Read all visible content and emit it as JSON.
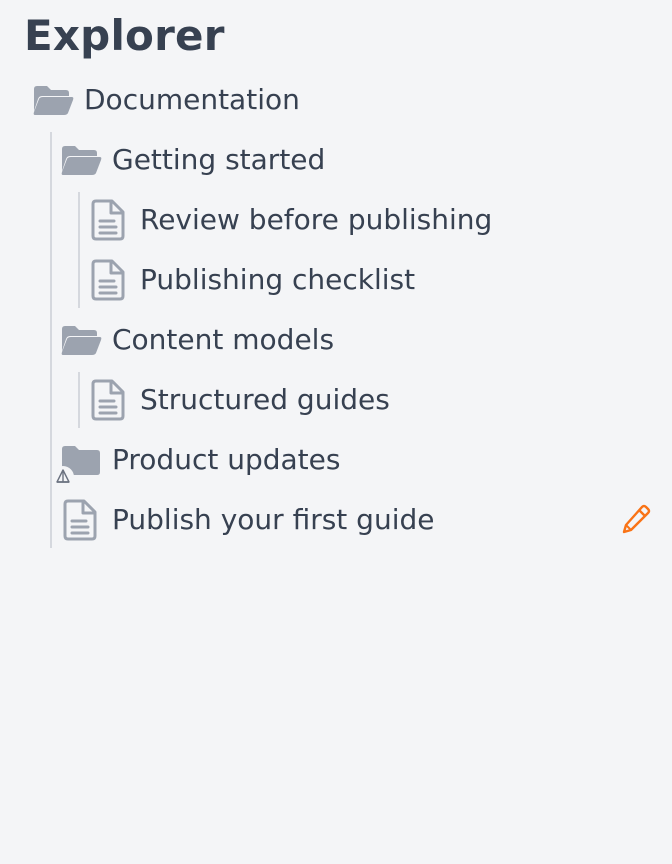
{
  "header": {
    "title": "Explorer"
  },
  "tree": {
    "documentation": "Documentation",
    "getting_started": "Getting started",
    "review_before_publishing": "Review before publishing",
    "publishing_checklist": "Publishing checklist",
    "content_models": "Content models",
    "structured_guides": "Structured guides",
    "product_updates": "Product updates",
    "publish_first_guide": "Publish your first guide"
  },
  "colors": {
    "background": "#f4f5f7",
    "text": "#374151",
    "icon": "#9ca3af",
    "accent": "#f97316",
    "guide_line": "#d5d8de"
  },
  "icons": {
    "open_folder": "folder-open-icon",
    "closed_folder": "folder-icon",
    "file": "document-icon",
    "edit": "pencil-icon",
    "unpublished": "cone-icon"
  }
}
